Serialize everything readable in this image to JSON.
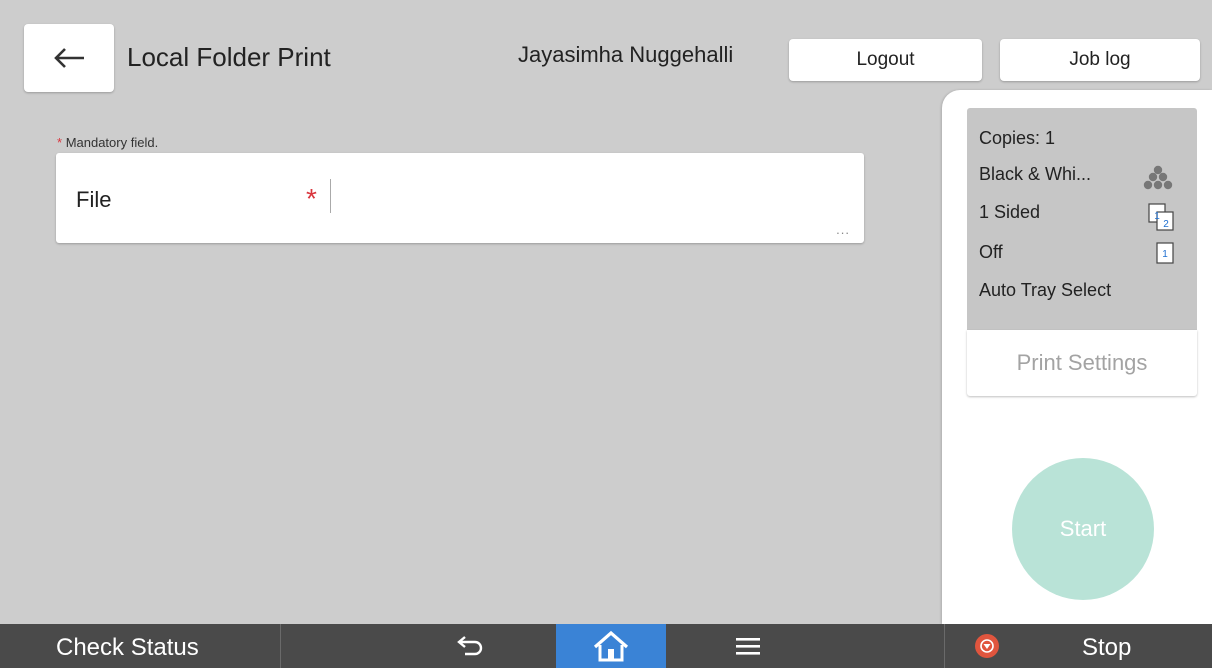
{
  "header": {
    "title": "Local Folder Print",
    "user": "Jayasimha Nuggehalli",
    "logout_label": "Logout",
    "joblog_label": "Job log"
  },
  "form": {
    "mandatory_star": "*",
    "mandatory_note": "Mandatory field.",
    "file_label": "File",
    "file_required_star": "*",
    "file_more": "..."
  },
  "settings": {
    "copies": "Copies: 1",
    "color": "Black & Whi...",
    "sides": "1 Sided",
    "combine": "Off",
    "tray": "Auto Tray Select",
    "print_settings_label": "Print Settings",
    "sided_icon_page1": "1",
    "sided_icon_page2": "2",
    "combine_icon_page": "1"
  },
  "start_label": "Start",
  "bottombar": {
    "check_status_label": "Check Status",
    "stop_label": "Stop",
    "home_color": "#3a83d6",
    "stop_color": "#e0553e"
  },
  "icons": [
    "back-arrow-icon",
    "color-dots-icon",
    "duplex-icon",
    "single-page-icon",
    "return-icon",
    "home-icon",
    "menu-icon",
    "stop-icon"
  ]
}
